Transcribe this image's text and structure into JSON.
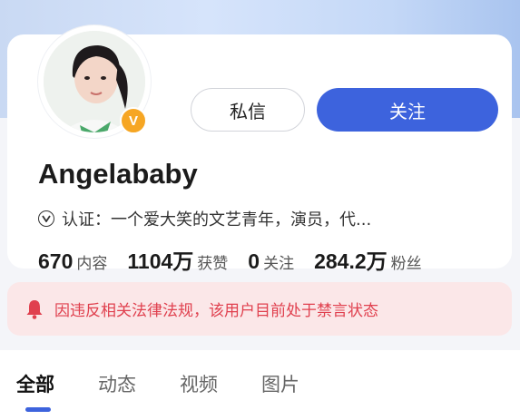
{
  "profile": {
    "name": "Angelababy",
    "badge": "V",
    "verification_prefix": "认证：",
    "verification_text": "一个爱大笑的文艺青年，演员，代..."
  },
  "actions": {
    "message_label": "私信",
    "follow_label": "关注"
  },
  "stats": [
    {
      "value": "670",
      "label": "内容"
    },
    {
      "value": "1104万",
      "label": "获赞"
    },
    {
      "value": "0",
      "label": "关注"
    },
    {
      "value": "284.2万",
      "label": "粉丝"
    }
  ],
  "notice": {
    "icon": "bell-icon",
    "text": "因违反相关法律法规，该用户目前处于禁言状态"
  },
  "tabs": [
    {
      "label": "全部",
      "active": true
    },
    {
      "label": "动态",
      "active": false
    },
    {
      "label": "视频",
      "active": false
    },
    {
      "label": "图片",
      "active": false
    }
  ],
  "colors": {
    "accent": "#3d63dd",
    "badge": "#f6a623",
    "warning_text": "#e0404e",
    "warning_bg": "#fbe7e8"
  }
}
